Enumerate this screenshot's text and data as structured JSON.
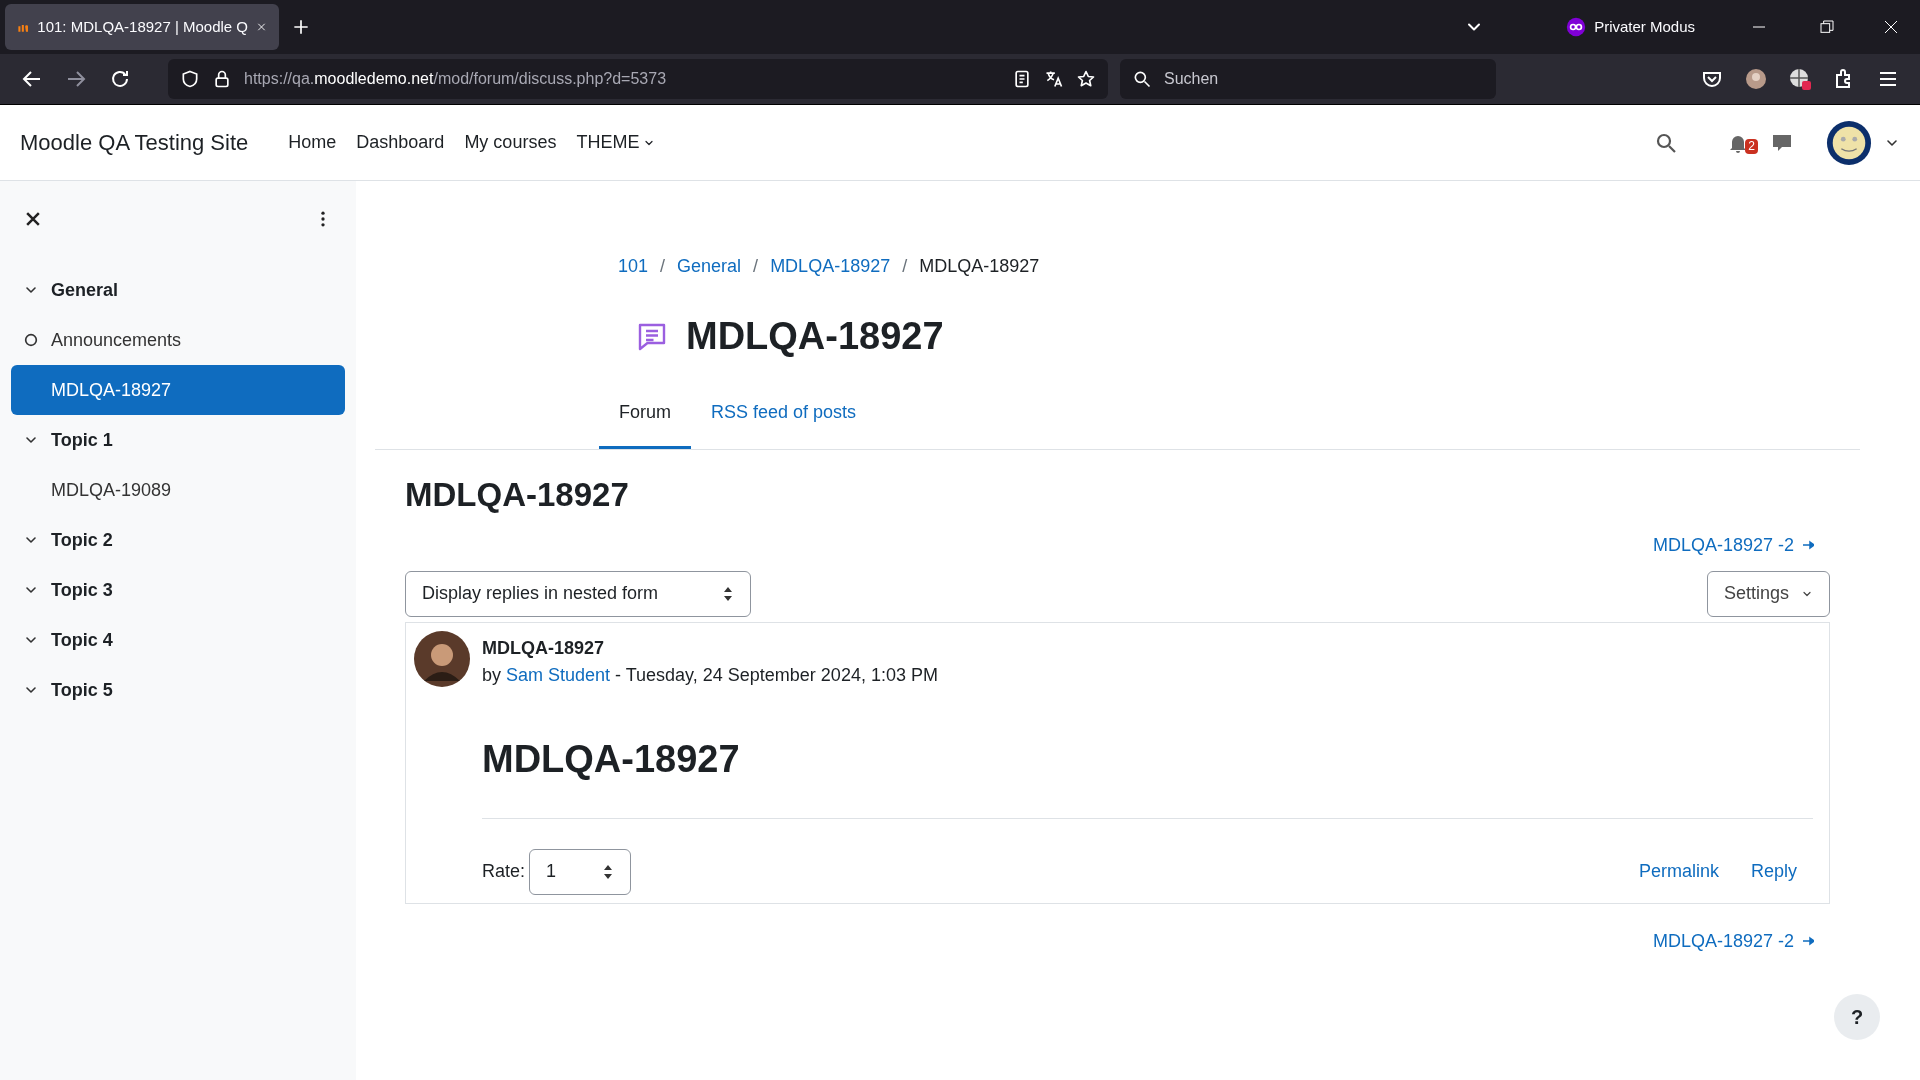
{
  "browser": {
    "tab_title": "101: MDLQA-18927 | Moodle Q",
    "url": {
      "scheme": "https://qa.",
      "domain": "moodledemo.net",
      "path": "/mod/forum/discuss.php?d=5373"
    },
    "search": {
      "placeholder": "Suchen"
    },
    "private_label": "Privater Modus"
  },
  "header": {
    "site_name": "Moodle QA Testing Site",
    "nav": [
      {
        "label": "Home",
        "kind": "link"
      },
      {
        "label": "Dashboard",
        "kind": "link"
      },
      {
        "label": "My courses",
        "kind": "link"
      },
      {
        "label": "THEME",
        "kind": "dropdown"
      }
    ],
    "notification_count": "2"
  },
  "sidebar": {
    "items": [
      {
        "label": "General",
        "expanded": true,
        "children": [
          {
            "label": "Announcements",
            "selected": false,
            "kind": "completion"
          },
          {
            "label": "MDLQA-18927",
            "selected": true,
            "kind": "plain"
          }
        ]
      },
      {
        "label": "Topic 1",
        "expanded": true,
        "children": [
          {
            "label": "MDLQA-19089",
            "selected": false,
            "kind": "plain"
          }
        ]
      },
      {
        "label": "Topic 2",
        "expanded": true
      },
      {
        "label": "Topic 3",
        "expanded": true
      },
      {
        "label": "Topic 4",
        "expanded": true
      },
      {
        "label": "Topic 5",
        "expanded": true
      }
    ]
  },
  "breadcrumb_separator": "/",
  "breadcrumb": [
    {
      "label": "101",
      "link": true
    },
    {
      "label": "General",
      "link": true
    },
    {
      "label": "MDLQA-18927",
      "link": true
    },
    {
      "label": "MDLQA-18927",
      "link": false
    }
  ],
  "page_title": "MDLQA-18927",
  "tabs": [
    {
      "label": "Forum",
      "selected": true
    },
    {
      "label": "RSS feed of posts",
      "selected": false
    }
  ],
  "discussion_title": "MDLQA-18927",
  "next_discussion_top": "MDLQA-18927 -2",
  "display_mode": "Display replies in nested form",
  "settings_button": "Settings",
  "post": {
    "subject": "MDLQA-18927",
    "byline_prefix": "by",
    "author": "Sam Student",
    "date": " - Tuesday, 24 September 2024, 1:03 PM",
    "body_heading": "MDLQA-18927",
    "rate_label": "Rate:",
    "rate_value": "1",
    "actions": [
      "Permalink",
      "Reply"
    ]
  },
  "next_discussion_bottom": "MDLQA-18927 -2",
  "help_button": "?"
}
